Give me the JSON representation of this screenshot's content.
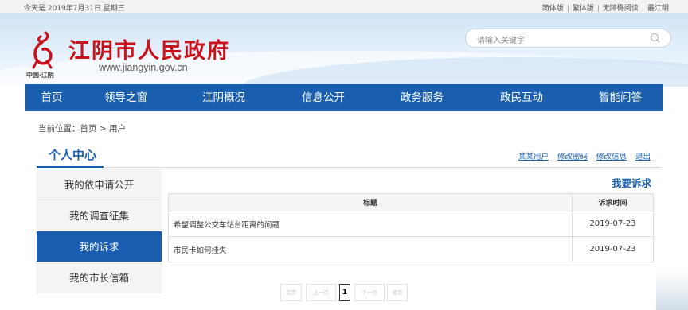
{
  "topbar": {
    "date": "今天是 2019年7月31日 星期三",
    "links": [
      "简体版",
      "繁体版",
      "无障碍阅读",
      "最江阴"
    ]
  },
  "header": {
    "title": "江阴市人民政府",
    "url": "www.jiangyin.gov.cn",
    "sub": "中国·江阴",
    "brand_color": "#c8121c"
  },
  "search": {
    "placeholder": "请输入关键字",
    "icon": "search-icon"
  },
  "nav": {
    "color": "#1a5eaf",
    "items": [
      "首页",
      "领导之窗",
      "江阴概况",
      "信息公开",
      "政务服务",
      "政民互动",
      "智能问答"
    ]
  },
  "breadcrumb": "当前位置：首页 > 用户",
  "user_center": {
    "title": "个人中心",
    "links": [
      "某某用户",
      "修改密码",
      "修改信息",
      "退出"
    ]
  },
  "sidebar": {
    "items": [
      "我的依申请公开",
      "我的调查征集",
      "我的诉求",
      "我的市长信箱"
    ],
    "active": "我的诉求"
  },
  "main": {
    "action": "我要诉求",
    "columns": [
      "标题",
      "诉求时间"
    ],
    "rows": [
      {
        "title": "希望调整公交车站台距离的问题",
        "date": "2019-07-23"
      },
      {
        "title": "市民卡如何挂失",
        "date": "2019-07-23"
      }
    ]
  },
  "pager": {
    "first": "首页",
    "prev": "上一页",
    "current": "1",
    "next": "下一页",
    "last": "尾页"
  }
}
